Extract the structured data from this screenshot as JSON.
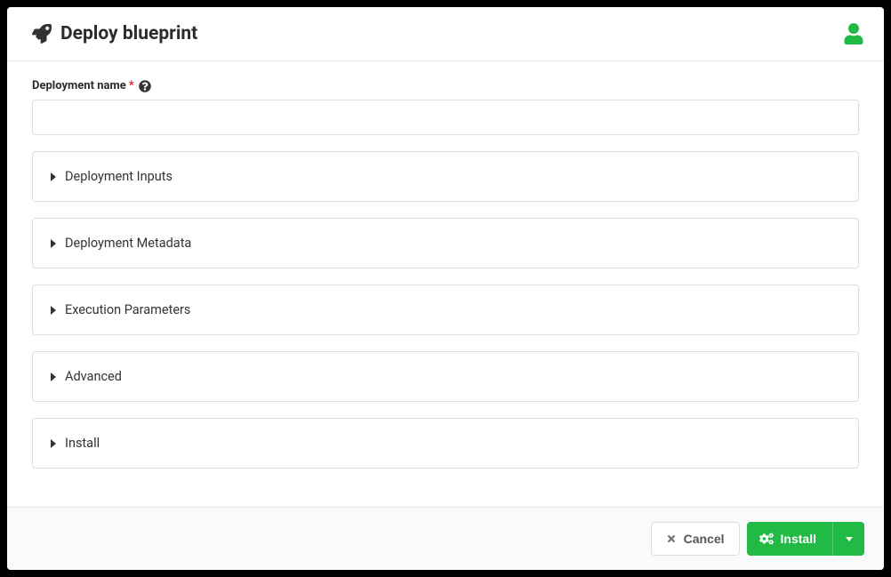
{
  "header": {
    "title": "Deploy blueprint"
  },
  "form": {
    "deployment_name_label": "Deployment name",
    "required_mark": "*",
    "deployment_name_value": ""
  },
  "accordions": [
    {
      "title": "Deployment Inputs"
    },
    {
      "title": "Deployment Metadata"
    },
    {
      "title": "Execution Parameters"
    },
    {
      "title": "Advanced"
    },
    {
      "title": "Install"
    }
  ],
  "footer": {
    "cancel_label": "Cancel",
    "install_label": "Install"
  }
}
